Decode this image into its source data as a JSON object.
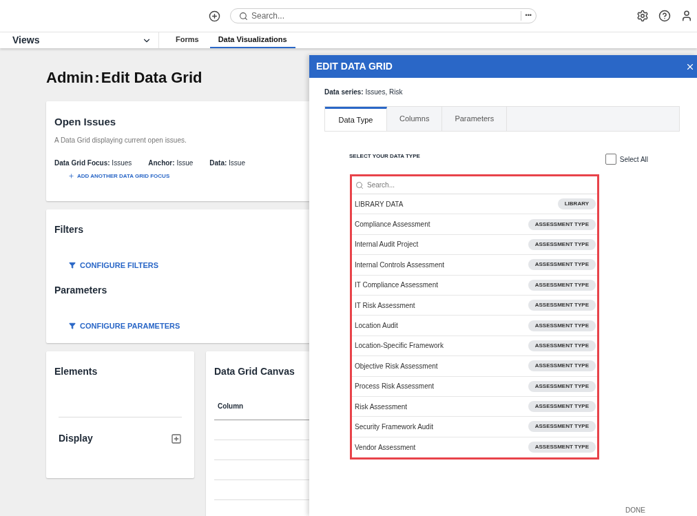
{
  "topbar": {
    "search": {
      "placeholder": "Search..."
    },
    "more": "•••"
  },
  "nav": {
    "views": "Views",
    "tabs": [
      {
        "label": "Forms",
        "selected": false
      },
      {
        "label": "Data Visualizations",
        "selected": true
      }
    ]
  },
  "page": {
    "title_prefix": "Admin",
    "title_separator": ":",
    "title": "Edit Data Grid",
    "open_issues": {
      "title": "Open Issues",
      "description": "A Data Grid displaying current open issues.",
      "fields": [
        {
          "label": "Data Grid Focus:",
          "value": "Issues"
        },
        {
          "label": "Anchor:",
          "value": "Issue"
        },
        {
          "label": "Data:",
          "value": "Issue"
        }
      ],
      "add_link": "ADD ANOTHER DATA GRID FOCUS"
    },
    "filters": {
      "title": "Filters",
      "link": "CONFIGURE FILTERS"
    },
    "parameters": {
      "title": "Parameters",
      "link": "CONFIGURE PARAMETERS"
    },
    "elements": {
      "title": "Elements",
      "display": "Display"
    },
    "canvas": {
      "title": "Data Grid Canvas",
      "column": "Column"
    }
  },
  "panel": {
    "title": "EDIT DATA GRID",
    "series_label": "Data series:",
    "series_value": "Issues, Risk",
    "tabs": [
      {
        "label": "Data Type",
        "selected": true
      },
      {
        "label": "Columns",
        "selected": false
      },
      {
        "label": "Parameters",
        "selected": false
      }
    ],
    "section_title": "SELECT YOUR DATA TYPE",
    "select_all": {
      "label": "Select All",
      "checked": false
    },
    "list_search": {
      "placeholder": "Search..."
    },
    "items": [
      {
        "name": "LIBRARY DATA",
        "tag": "LIBRARY"
      },
      {
        "name": "Compliance Assessment",
        "tag": "ASSESSMENT TYPE"
      },
      {
        "name": "Internal Audit Project",
        "tag": "ASSESSMENT TYPE"
      },
      {
        "name": "Internal Controls Assessment",
        "tag": "ASSESSMENT TYPE"
      },
      {
        "name": "IT Compliance Assessment",
        "tag": "ASSESSMENT TYPE"
      },
      {
        "name": "IT Risk Assessment",
        "tag": "ASSESSMENT TYPE"
      },
      {
        "name": "Location Audit",
        "tag": "ASSESSMENT TYPE"
      },
      {
        "name": "Location-Specific Framework",
        "tag": "ASSESSMENT TYPE"
      },
      {
        "name": "Objective Risk Assessment",
        "tag": "ASSESSMENT TYPE"
      },
      {
        "name": "Process Risk Assessment",
        "tag": "ASSESSMENT TYPE"
      },
      {
        "name": "Risk Assessment",
        "tag": "ASSESSMENT TYPE"
      },
      {
        "name": "Security Framework Audit",
        "tag": "ASSESSMENT TYPE"
      },
      {
        "name": "Vendor Assessment",
        "tag": "ASSESSMENT TYPE"
      }
    ],
    "done": "DONE"
  }
}
